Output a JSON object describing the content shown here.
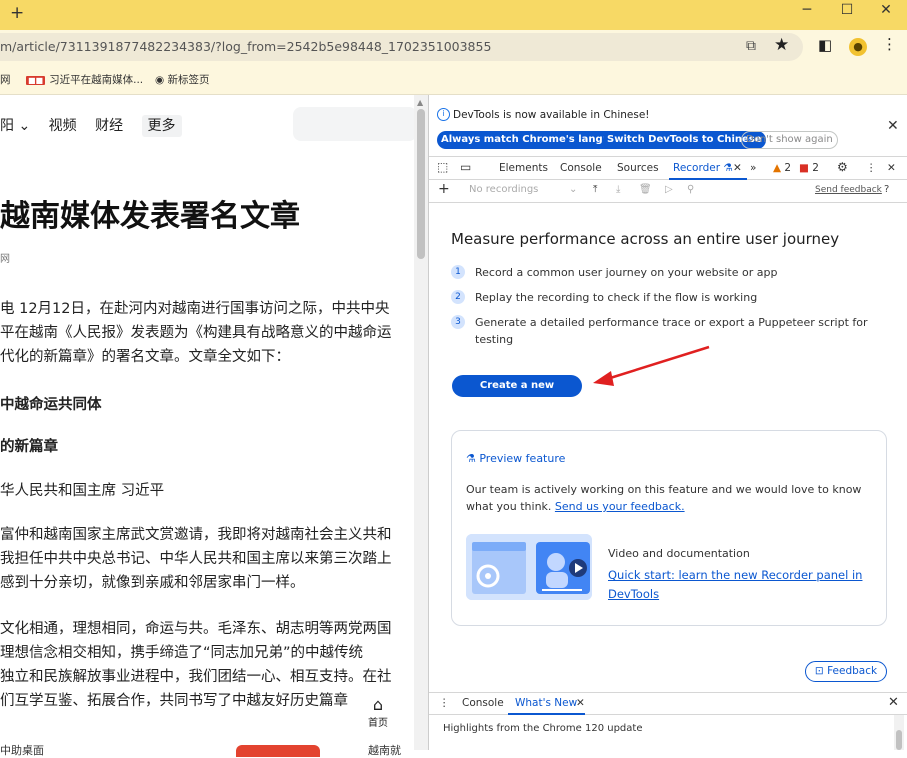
{
  "browser": {
    "new_tab": "+",
    "minimize": "─",
    "maximize": "☐",
    "close": "✕",
    "url": "m/article/7311391877482234383/?log_from=2542b5e98448_1702351003855"
  },
  "bookmarks": [
    {
      "label": "网"
    },
    {
      "badge": "■■",
      "label": "习近平在越南媒体..."
    },
    {
      "label": "新标签页"
    }
  ],
  "page": {
    "nav": [
      "阳 ⌄",
      "视频",
      "财经"
    ],
    "nav_more": "更多",
    "headline": "越南媒体发表署名文章",
    "source": "网",
    "paragraphs": [
      "电 12月12日，在赴河内对越南进行国事访问之际，中共中央",
      "平在越南《人民报》发表题为《构建具有战略意义的中越命运",
      "代化的新篇章》的署名文章。文章全文如下：",
      "中越命运共同体",
      "的新篇章",
      "华人民共和国主席 习近平",
      "富仲和越南国家主席武文赏邀请，我即将对越南社会主义共和",
      "我担任中共中央总书记、中华人民共和国主席以来第三次踏上",
      "感到十分亲切，就像到亲戚和邻居家串门一样。",
      "文化相通，理想相同，命运与共。毛泽东、胡志明等两党两国",
      "理想信念相交相知，携手缔造了“同志加兄弟”的中越传统",
      "独立和民族解放事业进程中，我们团结一心、相互支持。在社",
      "们互学互鉴、拓展合作，共同书写了中越友好历史篇章"
    ],
    "home_label": "首页",
    "bottom_left": "中助桌面",
    "bottom_right": "越南就"
  },
  "devtools": {
    "info_text": "DevTools is now available in Chinese!",
    "btn_match": "Always match Chrome's language",
    "btn_switch": "Switch DevTools to Chinese",
    "btn_dont_show": "Don't show again",
    "tabs": [
      "Elements",
      "Console",
      "Sources"
    ],
    "active_tab": "Recorder ⚗",
    "more_tabs": "»",
    "warnings": "2",
    "errors": "2",
    "no_recordings": "No recordings",
    "send_feedback": "Send feedback",
    "recorder": {
      "title": "Measure performance across an entire user journey",
      "steps": [
        {
          "num": "1",
          "text": "Record a common user journey on your website or app"
        },
        {
          "num": "2",
          "text": "Replay the recording to check if the flow is working"
        },
        {
          "num": "3",
          "text": "Generate a detailed performance trace or export a Puppeteer script for testing"
        }
      ],
      "create_button": "Create a new recording",
      "preview_feature": "Preview feature",
      "preview_desc": "Our team is actively working on this feature and we would love to know what you think.",
      "preview_link": "Send us your feedback.",
      "video_title": "Video and documentation",
      "video_link": "Quick start: learn the new Recorder panel in DevTools",
      "feedback_button": "Feedback"
    },
    "drawer": {
      "tabs": [
        "Console"
      ],
      "active_tab": "What's New",
      "highlights": "Highlights from the Chrome 120 update"
    }
  },
  "colors": {
    "accent": "#0b57d0",
    "tabstrip": "#f7d965",
    "annotation_arrow": "#e02020"
  }
}
